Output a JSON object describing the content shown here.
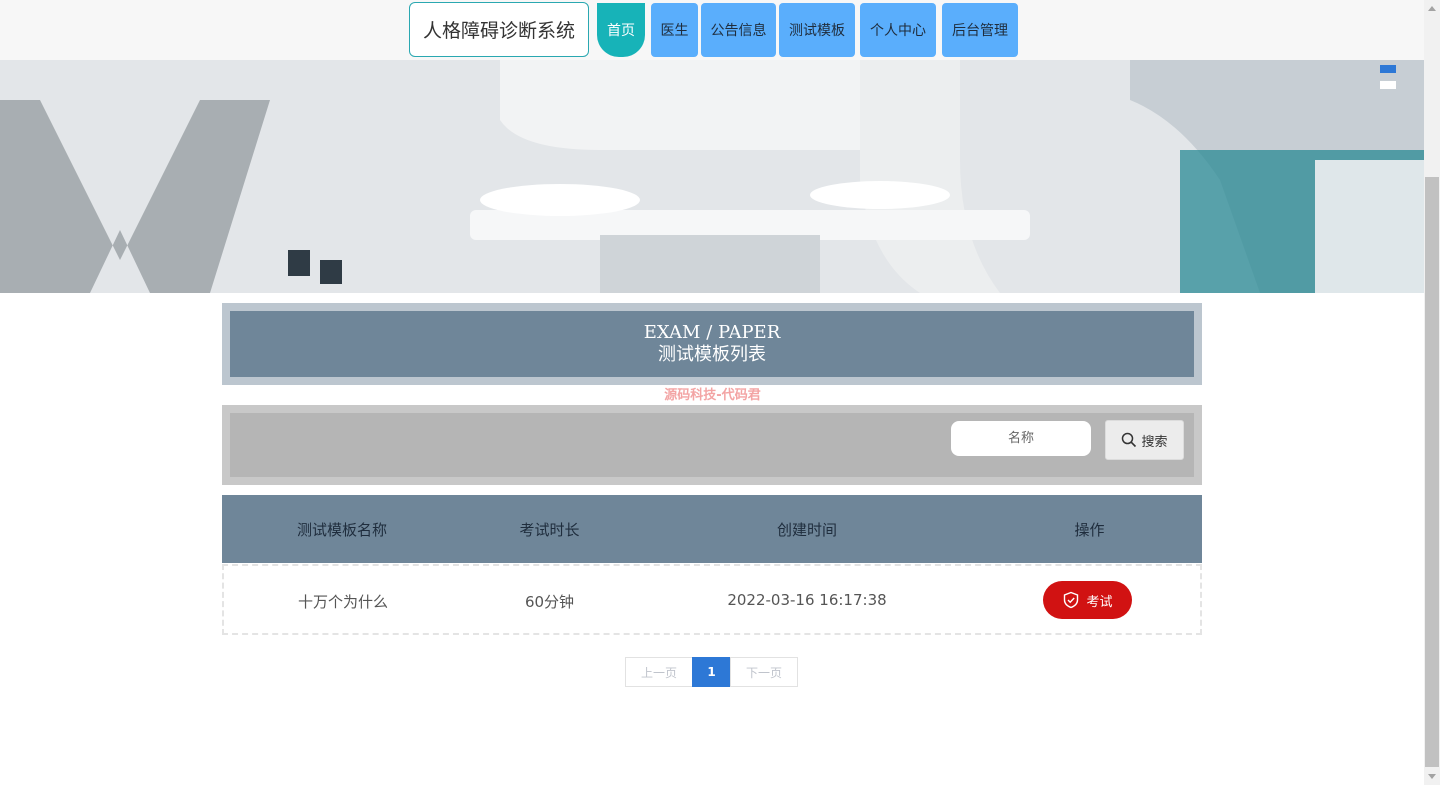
{
  "site": {
    "title": "人格障碍诊断系统"
  },
  "nav": {
    "items": [
      {
        "label": "首页",
        "active": true
      },
      {
        "label": "医生"
      },
      {
        "label": "公告信息"
      },
      {
        "label": "测试模板"
      },
      {
        "label": "个人中心"
      },
      {
        "label": "后台管理"
      }
    ]
  },
  "banner": {
    "down_icon": "chevron-down-icon"
  },
  "section": {
    "title_en": "EXAM / PAPER",
    "title_cn": "测试模板列表",
    "watermark": "源码科技-代码君"
  },
  "search": {
    "placeholder": "名称",
    "button_label": "搜索",
    "icon": "search-icon"
  },
  "table": {
    "headers": [
      "测试模板名称",
      "考试时长",
      "创建时间",
      "操作"
    ],
    "rows": [
      {
        "name": "十万个为什么",
        "duration": "60分钟",
        "created": "2022-03-16 16:17:38",
        "action": "考试"
      }
    ]
  },
  "pagination": {
    "prev": "上一页",
    "current": "1",
    "next": "下一页"
  },
  "colors": {
    "accent": "#17b3b8",
    "nav": "#5aaefc",
    "header": "#6f8699",
    "danger": "#d11212",
    "pager": "#2d78d6"
  }
}
